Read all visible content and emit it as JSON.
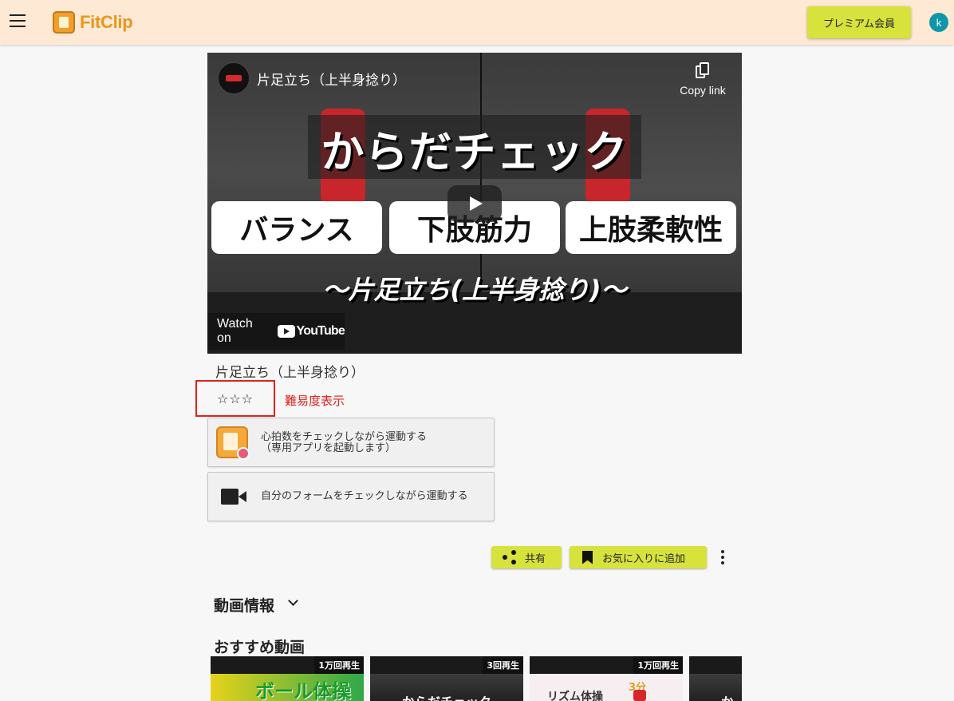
{
  "app": {
    "logo_text": "FitClip",
    "premium_label": "プレミアム会員",
    "avatar_letter": "k"
  },
  "video": {
    "title": "片足立ち（上半身捻り）",
    "copy_link": "Copy link",
    "headline": "からだチェック",
    "tags": [
      "バランス",
      "下肢筋力",
      "上肢柔軟性"
    ],
    "subheadline": "〜片足立ち(上半身捻り)〜",
    "watch_on": "Watch on",
    "youtube": "YouTube"
  },
  "exercise": {
    "title": "片足立ち（上半身捻り）",
    "stars": "☆☆☆",
    "difficulty_label": "難易度表示"
  },
  "actions": {
    "heart_rate_line1": "心拍数をチェックしながら運動する",
    "heart_rate_line2": "（専用アプリを起動します）",
    "form_check": "自分のフォームをチェックしながら運動する",
    "share": "共有",
    "favorite": "お気に入りに追加"
  },
  "sections": {
    "video_info": "動画情報",
    "recommended": "おすすめ動画"
  },
  "recommended": [
    {
      "views": "1万回再生",
      "caption": "ボール体操"
    },
    {
      "views": "3回再生",
      "caption": "からだチェック"
    },
    {
      "views": "1万回再生",
      "caption": "リズム体操",
      "badge": "3分"
    },
    {
      "views": "",
      "caption": "から"
    }
  ],
  "colors": {
    "appbar": "#fde9d4",
    "accent_button": "#d7e33c",
    "difficulty_red": "#e0211b",
    "avatar": "#0f97a8"
  }
}
